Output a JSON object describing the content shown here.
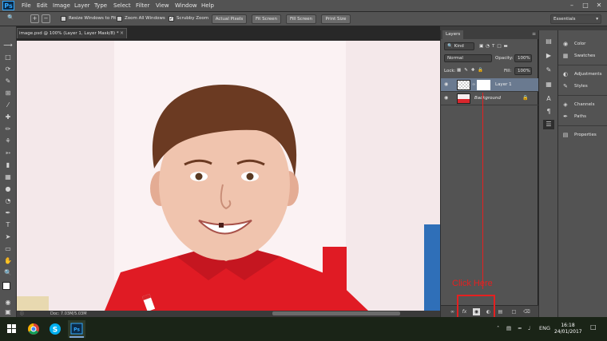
{
  "app": {
    "logo": "Ps"
  },
  "menu": [
    "File",
    "Edit",
    "Image",
    "Layer",
    "Type",
    "Select",
    "Filter",
    "View",
    "Window",
    "Help"
  ],
  "options": {
    "resize_windows": "Resize Windows to Fit",
    "zoom_all": "Zoom All Windows",
    "scrubby_zoom": "Scrubby Zoom",
    "actual_pixels": "Actual Pixels",
    "fit_screen": "Fit Screen",
    "fill_screen": "Fill Screen",
    "print_size": "Print Size",
    "workspace": "Essentials"
  },
  "document": {
    "tab_title": "image.psd @ 100% (Layer 1, Layer Mask/8) *",
    "status": "Doc: 7.03M/5.03M"
  },
  "layers_panel": {
    "tab": "Layers",
    "kind": "Kind",
    "blend_mode": "Normal",
    "opacity_label": "Opacity:",
    "opacity_value": "100%",
    "lock_label": "Lock:",
    "fill_label": "Fill:",
    "fill_value": "100%",
    "layers": [
      {
        "name": "Layer 1",
        "selected": true
      },
      {
        "name": "Background",
        "selected": false
      }
    ]
  },
  "right_panels": [
    "Color",
    "Swatches",
    "Adjustments",
    "Styles",
    "Channels",
    "Paths",
    "Properties"
  ],
  "annotation": {
    "text": "Click Here",
    "color": "#e52020"
  },
  "taskbar": {
    "language": "ENG",
    "time": "16:18",
    "date": "24/01/2017"
  },
  "colors": {
    "ui_panel": "#535353",
    "photoshop_blue": "#31a8ff",
    "shirt_red": "#e01b24",
    "background_pink": "#f4e8ea"
  }
}
